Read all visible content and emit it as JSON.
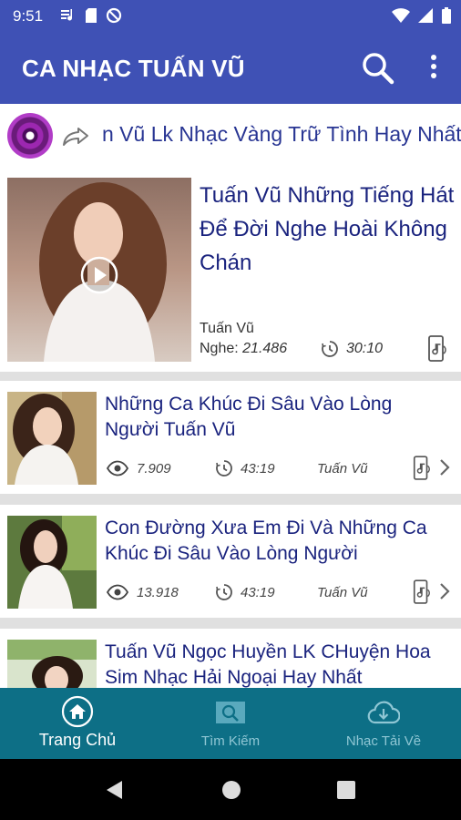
{
  "status": {
    "time": "9:51"
  },
  "app": {
    "title": "CA NHẠC TUẤN VŨ"
  },
  "now_playing": {
    "marquee": "n Vũ Lk Nhạc Vàng Trữ Tình Hay Nhất"
  },
  "featured": {
    "title": "Tuấn Vũ Những Tiếng Hát Để Đời Nghe Hoài Không Chán",
    "artist": "Tuấn Vũ",
    "listens_label": "Nghe:",
    "listens": "21.486",
    "duration": "30:10"
  },
  "songs": [
    {
      "title": "Những Ca Khúc Đi Sâu Vào Lòng Người Tuấn Vũ",
      "views": "7.909",
      "duration": "43:19",
      "artist": "Tuấn Vũ"
    },
    {
      "title": "Con Đường Xưa Em Đi Và Những Ca Khúc Đi Sâu Vào Lòng Người",
      "views": "13.918",
      "duration": "43:19",
      "artist": "Tuấn Vũ"
    },
    {
      "title": "Tuấn Vũ Ngọc Huyền LK CHuyện Hoa Sim Nhạc Hải Ngoại Hay Nhất",
      "views": "",
      "duration": "",
      "artist": ""
    }
  ],
  "nav": {
    "home": "Trang Chủ",
    "search": "Tìm Kiếm",
    "downloads": "Nhạc Tải Về"
  },
  "colors": {
    "primary": "#3f51b5",
    "title_text": "#1a237e",
    "bottom_nav": "#0d6f86"
  }
}
